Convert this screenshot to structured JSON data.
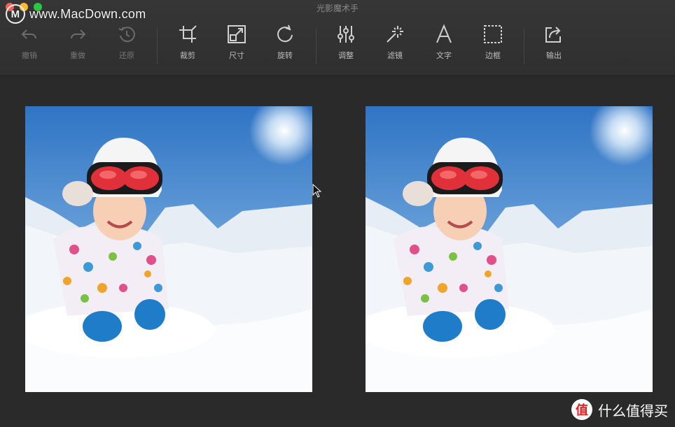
{
  "window": {
    "title": "光影魔术手"
  },
  "watermark": {
    "text": "www.MacDown.com",
    "logo_letter": "M"
  },
  "toolbar": {
    "items": [
      {
        "id": "undo",
        "label": "撤销",
        "icon": "undo-icon",
        "enabled": false
      },
      {
        "id": "redo",
        "label": "重做",
        "icon": "redo-icon",
        "enabled": false
      },
      {
        "id": "restore",
        "label": "还原",
        "icon": "restore-icon",
        "enabled": false
      },
      {
        "id": "crop",
        "label": "裁剪",
        "icon": "crop-icon",
        "enabled": true
      },
      {
        "id": "size",
        "label": "尺寸",
        "icon": "resize-icon",
        "enabled": true
      },
      {
        "id": "rotate",
        "label": "旋转",
        "icon": "rotate-icon",
        "enabled": true
      },
      {
        "id": "adjust",
        "label": "调整",
        "icon": "sliders-icon",
        "enabled": true
      },
      {
        "id": "filter",
        "label": "滤镜",
        "icon": "magic-wand-icon",
        "enabled": true
      },
      {
        "id": "text",
        "label": "文字",
        "icon": "text-icon",
        "enabled": true
      },
      {
        "id": "border",
        "label": "边框",
        "icon": "border-icon",
        "enabled": true
      },
      {
        "id": "export",
        "label": "输出",
        "icon": "share-icon",
        "enabled": true
      }
    ]
  },
  "footer_badge": {
    "text": "什么值得买",
    "glyph": "值"
  },
  "colors": {
    "background": "#2a2a2a",
    "toolbar": "#333333",
    "sky": "#2f7fd0",
    "snow": "#f4f7fb",
    "goggles": "#e0303a"
  }
}
